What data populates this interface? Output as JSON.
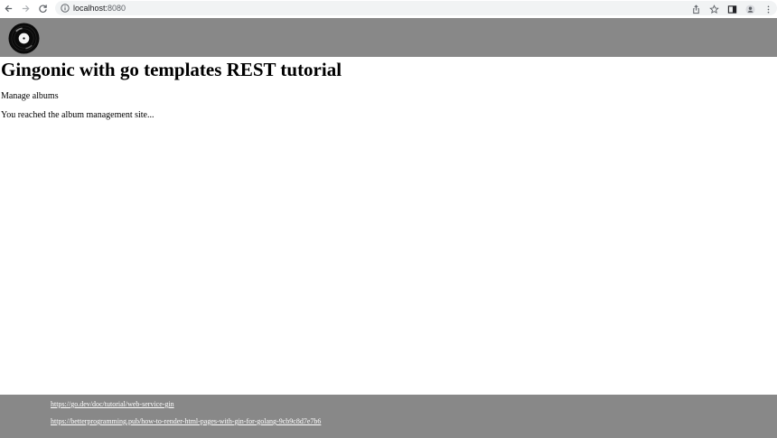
{
  "browser": {
    "url_host": "localhost:",
    "url_port": "8080"
  },
  "page": {
    "title": "Gingonic with go templates REST tutorial",
    "subtitle": "Manage albums",
    "message": "You reached the album management site..."
  },
  "footer": {
    "links": [
      "https://go.dev/doc/tutorial/web-service-gin",
      "https://betterprogramming.pub/how-to-render-html-pages-with-gin-for-golang-9cb9c8d7e7b6"
    ]
  },
  "colors": {
    "header_bg": "#888888",
    "footer_bg": "#888888",
    "link": "#ffffff"
  },
  "icons": [
    "back-arrow-icon",
    "forward-arrow-icon",
    "reload-icon",
    "info-icon",
    "share-icon",
    "star-icon",
    "side-panel-icon",
    "profile-icon",
    "menu-kebab-icon",
    "vinyl-record-icon"
  ]
}
